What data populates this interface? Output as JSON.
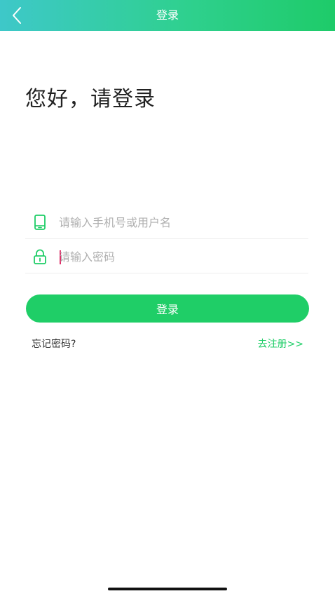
{
  "header": {
    "title": "登录",
    "back_icon": "chevron-left-icon"
  },
  "greeting": "您好，请登录",
  "form": {
    "username": {
      "placeholder": "请输入手机号或用户名",
      "value": "",
      "icon": "phone-icon"
    },
    "password": {
      "placeholder": "请输入密码",
      "value": "",
      "icon": "lock-icon"
    }
  },
  "actions": {
    "login_label": "登录",
    "forgot_label": "忘记密码?",
    "register_label": "去注册>>"
  },
  "colors": {
    "accent": "#1fce67",
    "header_start": "#3ec8c9",
    "header_end": "#1ecb69"
  }
}
